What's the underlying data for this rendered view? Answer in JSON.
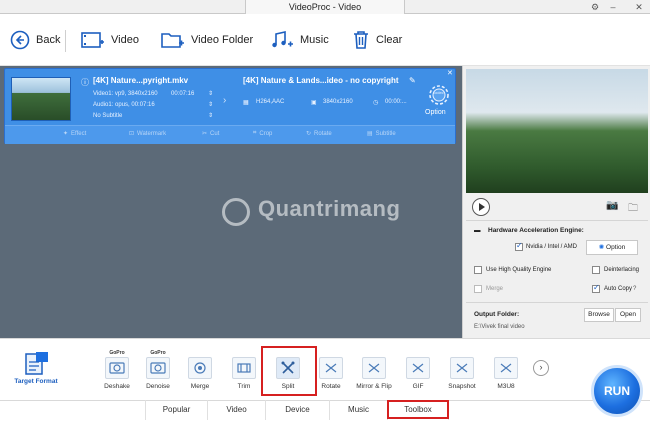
{
  "window": {
    "title": "VideoProc - Video"
  },
  "toolbar": {
    "back": "Back",
    "video": "Video",
    "video_folder": "Video Folder",
    "music": "Music",
    "clear": "Clear"
  },
  "task": {
    "source_name": "[4K] Nature...pyright.mkv",
    "video_info": "Video1: vp9, 3840x2160",
    "video_duration": "00:07:16",
    "audio_info": "Audio1: opus, 00:07:16",
    "subtitle": "No Subtitle",
    "output_name": "[4K] Nature & Lands...ideo - no copyright",
    "codec": "H264,AAC",
    "resolution": "3840x2160",
    "duration": "00:00:...",
    "option_label": "Option",
    "codec_badge": "codec",
    "tools": [
      "Effect",
      "Watermark",
      "Cut",
      "Crop",
      "Rotate",
      "Subtitle"
    ]
  },
  "watermark": "Quantrimang",
  "right_panel": {
    "hw_label": "Hardware Acceleration Engine:",
    "hw_vendor": "Nvidia / Intel / AMD",
    "option_btn": "Option",
    "high_quality": "Use High Quality Engine",
    "deinterlacing": "Deinterlacing",
    "merge": "Merge",
    "auto_copy": "Auto Copy",
    "output_folder_label": "Output Folder:",
    "output_path": "E:\\Vivek final video",
    "browse": "Browse",
    "open": "Open"
  },
  "bottom": {
    "target_format": "Target Format",
    "gopro_label": "GoPro",
    "tools": [
      "Deshake",
      "Denoise",
      "Merge",
      "Trim",
      "Split",
      "Rotate",
      "Mirror & Flip",
      "GIF",
      "Snapshot",
      "M3U8"
    ],
    "tabs": [
      "Popular",
      "Video",
      "Device",
      "Music",
      "Toolbox"
    ],
    "run": "RUN"
  },
  "colors": {
    "accent": "#3f8fe6",
    "highlight": "#d62020",
    "work_bg": "#5c6a78"
  }
}
